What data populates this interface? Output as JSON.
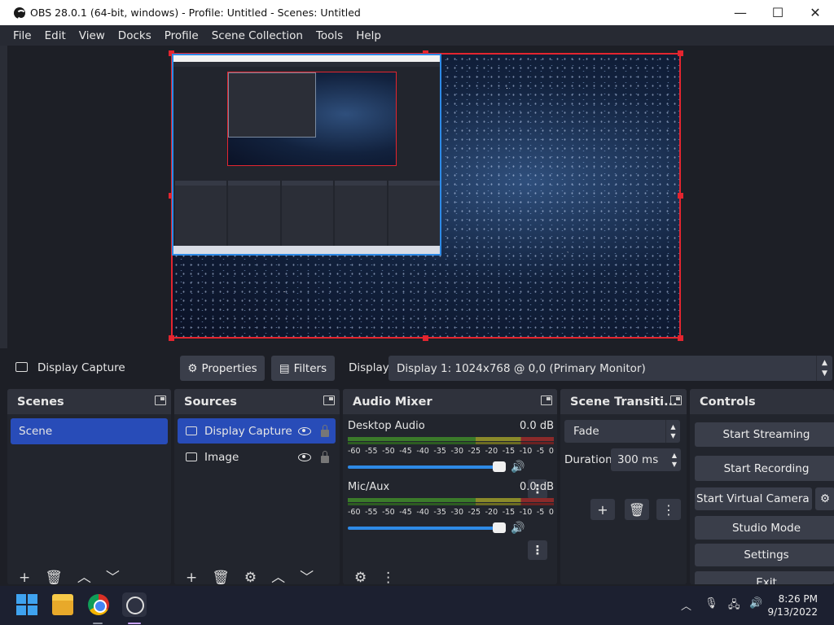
{
  "window": {
    "title": "OBS 28.0.1 (64-bit, windows) - Profile: Untitled - Scenes: Untitled",
    "minimize": "—",
    "maximize": "☐",
    "close": "✕"
  },
  "menu": [
    "File",
    "Edit",
    "View",
    "Docks",
    "Profile",
    "Scene Collection",
    "Tools",
    "Help"
  ],
  "source_bar": {
    "selected_source": "Display Capture",
    "properties_label": "Properties",
    "filters_label": "Filters",
    "display_label": "Display",
    "display_value": "Display 1: 1024x768 @ 0,0 (Primary Monitor)"
  },
  "scenes": {
    "title": "Scenes",
    "items": [
      "Scene"
    ]
  },
  "sources": {
    "title": "Sources",
    "items": [
      "Display Capture",
      "Image"
    ]
  },
  "audio_mixer": {
    "title": "Audio Mixer",
    "channels": [
      {
        "name": "Desktop Audio",
        "level": "0.0 dB",
        "volume": 1.0
      },
      {
        "name": "Mic/Aux",
        "level": "0.0 dB",
        "volume": 1.0
      }
    ],
    "scale": [
      "-60",
      "-55",
      "-50",
      "-45",
      "-40",
      "-35",
      "-30",
      "-25",
      "-20",
      "-15",
      "-10",
      "-5",
      "0"
    ]
  },
  "transitions": {
    "title": "Scene Transiti...",
    "type": "Fade",
    "duration_label": "Duration",
    "duration_value": "300 ms"
  },
  "controls": {
    "title": "Controls",
    "start_streaming": "Start Streaming",
    "start_recording": "Start Recording",
    "start_virtual_camera": "Start Virtual Camera",
    "studio_mode": "Studio Mode",
    "settings": "Settings",
    "exit": "Exit"
  },
  "taskbar": {
    "time": "8:26 PM",
    "date": "9/13/2022"
  },
  "colors": {
    "accent": "#284cb8",
    "selection_red": "#e4252f",
    "nested_blue": "#2e8ae6"
  }
}
